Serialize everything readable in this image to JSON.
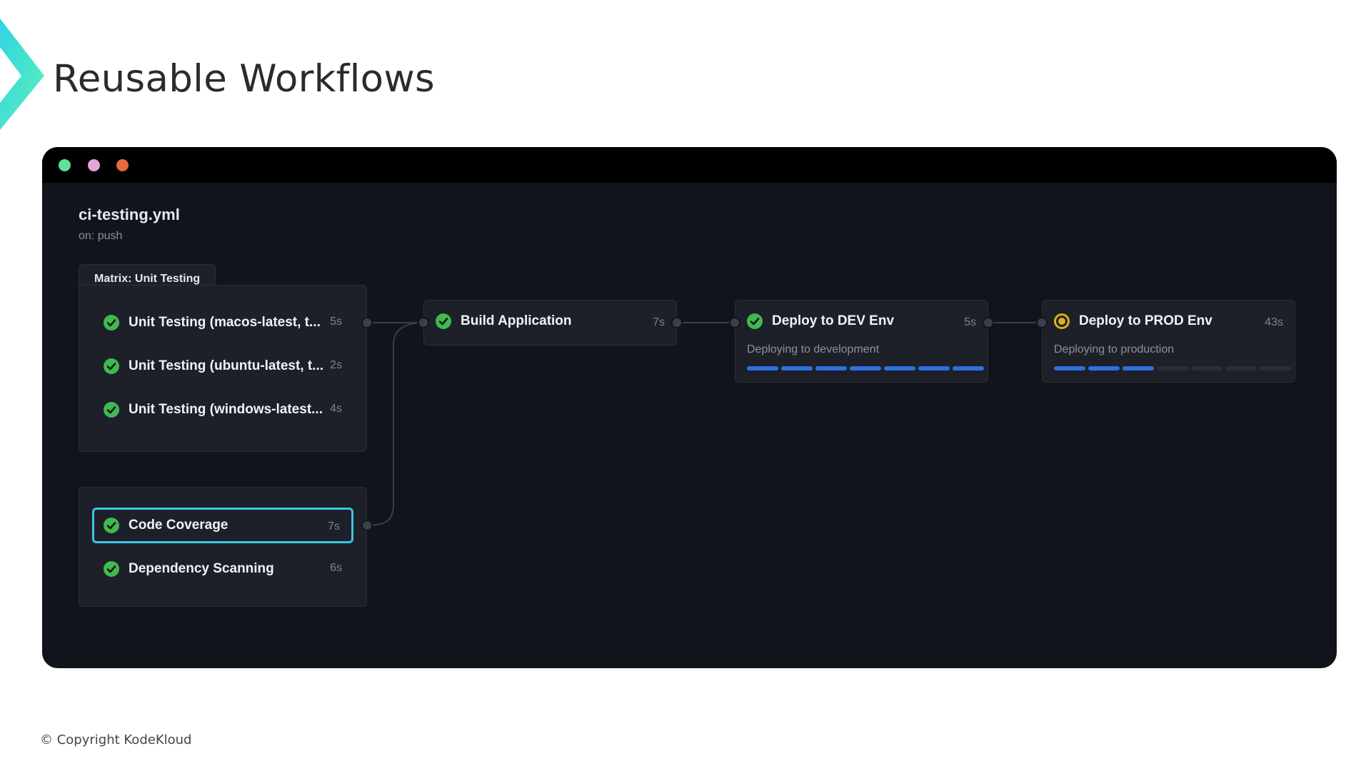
{
  "slide": {
    "title": "Reusable Workflows",
    "copyright": "© Copyright KodeKloud"
  },
  "window": {
    "dots": [
      {
        "name": "green-dot",
        "color": "#5ee29a"
      },
      {
        "name": "pink-dot",
        "color": "#e3a6d6"
      },
      {
        "name": "orange-dot",
        "color": "#e86a3e"
      }
    ]
  },
  "workflow": {
    "name": "ci-testing.yml",
    "trigger": "on: push"
  },
  "matrix": {
    "label": "Matrix: Unit Testing",
    "jobs": [
      {
        "label": "Unit Testing (macos-latest, t...",
        "duration": "5s",
        "status": "success"
      },
      {
        "label": "Unit Testing (ubuntu-latest, t...",
        "duration": "2s",
        "status": "success"
      },
      {
        "label": "Unit Testing (windows-latest...",
        "duration": "4s",
        "status": "success"
      }
    ]
  },
  "checks": {
    "jobs": [
      {
        "label": "Code Coverage",
        "duration": "7s",
        "status": "success",
        "selected": true
      },
      {
        "label": "Dependency Scanning",
        "duration": "6s",
        "status": "success",
        "selected": false
      }
    ]
  },
  "build": {
    "label": "Build Application",
    "duration": "7s",
    "status": "success"
  },
  "deploy_dev": {
    "label": "Deploy to DEV Env",
    "duration": "5s",
    "status": "success",
    "step": "Deploying to development",
    "progress": {
      "done": 7,
      "total": 7
    }
  },
  "deploy_prod": {
    "label": "Deploy to PROD Env",
    "duration": "43s",
    "status": "in-progress",
    "step": "Deploying to production",
    "progress": {
      "done": 3,
      "total": 7
    }
  },
  "colors": {
    "success": "#3fb950",
    "in_progress": "#d8b21b",
    "progress_fill": "#2f6fe0",
    "selected_border": "#3fc3e6",
    "logo": "#3fe0c8"
  },
  "icons": {
    "success": "check-circle-icon",
    "in_progress": "in-progress-circle-icon"
  }
}
